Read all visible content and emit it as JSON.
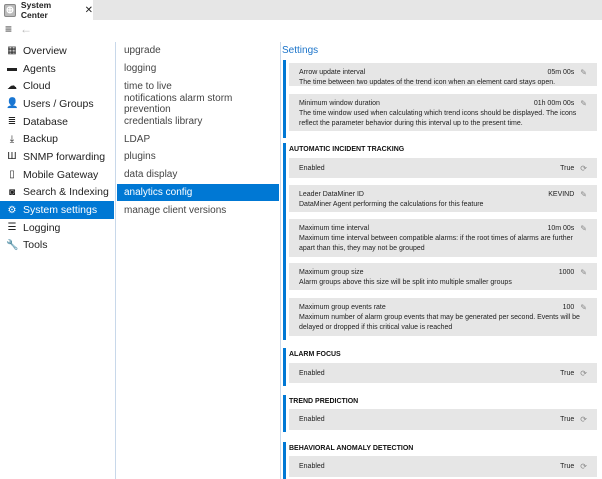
{
  "tab": {
    "title": "System Center",
    "close": "✕"
  },
  "toolbar": {
    "menu": "≡",
    "back": "←"
  },
  "nav": [
    {
      "label": "Overview",
      "icon": "▦"
    },
    {
      "label": "Agents",
      "icon": "▬"
    },
    {
      "label": "Cloud",
      "icon": "☁"
    },
    {
      "label": "Users / Groups",
      "icon": "👤"
    },
    {
      "label": "Database",
      "icon": "≣"
    },
    {
      "label": "Backup",
      "icon": "⤓"
    },
    {
      "label": "SNMP forwarding",
      "icon": "Ш"
    },
    {
      "label": "Mobile Gateway",
      "icon": "▯"
    },
    {
      "label": "Search & Indexing",
      "icon": "◙"
    },
    {
      "label": "System settings",
      "icon": "⚙"
    },
    {
      "label": "Logging",
      "icon": "☰"
    },
    {
      "label": "Tools",
      "icon": "🔧"
    }
  ],
  "submenu": [
    "upgrade",
    "logging",
    "time to live",
    "notifications alarm storm prevention",
    "credentials library",
    "LDAP",
    "plugins",
    "data display",
    "analytics config",
    "manage client versions"
  ],
  "settings_title": "Settings",
  "groups": [
    {
      "title": "",
      "cards": [
        {
          "label": "Arrow update interval",
          "value": "05m 00s",
          "action": "edit",
          "desc": "The time between two updates of the trend icon when an element card stays open."
        },
        {
          "label": "Minimum window duration",
          "value": "01h 00m 00s",
          "action": "edit",
          "desc": "The time window used when calculating which trend icons should be displayed. The icons reflect the parameter behavior during this interval up to the present time."
        }
      ]
    },
    {
      "title": "AUTOMATIC INCIDENT TRACKING",
      "cards": [
        {
          "label": "Enabled",
          "value": "True",
          "action": "toggle",
          "desc": ""
        },
        {
          "label": "Leader DataMiner ID",
          "value": "KEVIND",
          "action": "edit",
          "desc": "DataMiner Agent performing the calculations for this feature"
        },
        {
          "label": "Maximum time interval",
          "value": "10m 00s",
          "action": "edit",
          "desc": "Maximum time interval between compatible alarms: if the root times of alarms are further apart than this, they may not be grouped"
        },
        {
          "label": "Maximum group size",
          "value": "1000",
          "action": "edit",
          "desc": "Alarm groups above this size will be split into multiple smaller groups"
        },
        {
          "label": "Maximum group events rate",
          "value": "100",
          "action": "edit",
          "desc": "Maximum number of alarm group events that may be generated per second. Events will be delayed or dropped if this critical value is reached"
        }
      ]
    },
    {
      "title": "ALARM FOCUS",
      "cards": [
        {
          "label": "Enabled",
          "value": "True",
          "action": "toggle",
          "desc": ""
        }
      ]
    },
    {
      "title": "TREND PREDICTION",
      "cards": [
        {
          "label": "Enabled",
          "value": "True",
          "action": "toggle",
          "desc": ""
        }
      ]
    },
    {
      "title": "BEHAVIORAL ANOMALY DETECTION",
      "cards": [
        {
          "label": "Enabled",
          "value": "True",
          "action": "toggle",
          "desc": ""
        }
      ]
    }
  ],
  "colors": {
    "accent": "#0078d4",
    "card": "#e6e6e6"
  }
}
